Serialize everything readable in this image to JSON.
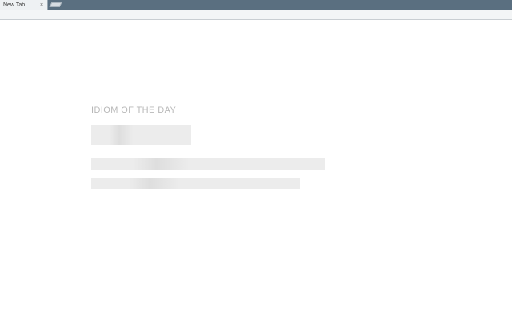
{
  "browser": {
    "tabs": [
      {
        "title": "New Tab",
        "close_glyph": "×",
        "active": true
      }
    ],
    "new_tab_icon": "new-tab-icon"
  },
  "page": {
    "heading": "IDIOM OF THE DAY",
    "loading_placeholders": [
      "title",
      "line",
      "line"
    ]
  }
}
